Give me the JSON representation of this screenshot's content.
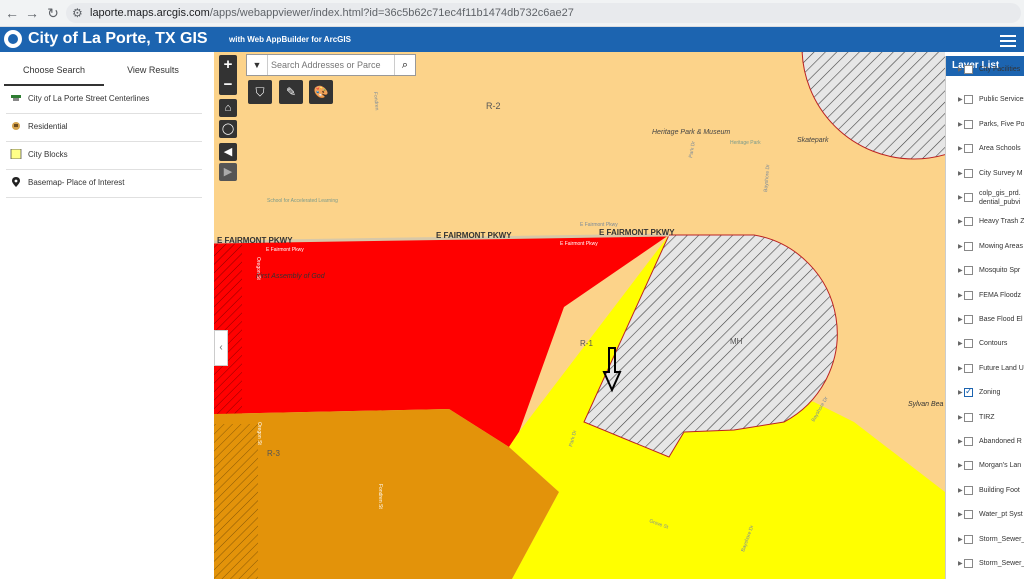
{
  "browser": {
    "url_host": "laporte.maps.arcgis.com",
    "url_path": "/apps/webappviewer/index.html?id=36c5b62c71ec4f11b1474db732c6ae27"
  },
  "header": {
    "title": "City of La Porte, TX GIS",
    "subtitle": "with Web AppBuilder for ArcGIS",
    "accent": "#1c64b0"
  },
  "left_panel": {
    "tabs": [
      {
        "label": "Choose Search",
        "active": true
      },
      {
        "label": "View Results",
        "active": false
      }
    ],
    "items": [
      {
        "label": "City of La Porte Street Centerlines",
        "icon": "street-layer-icon"
      },
      {
        "label": "Residential",
        "icon": "residential-layer-icon"
      },
      {
        "label": "City Blocks",
        "icon": "city-blocks-icon"
      },
      {
        "label": "Basemap- Place of Interest",
        "icon": "map-pin-icon"
      }
    ]
  },
  "search": {
    "placeholder": "Search Addresses or Parce"
  },
  "map": {
    "labels": {
      "r2": "R-2",
      "heritage": "Heritage Park & Museum",
      "heritage_small": "Heritage Park",
      "skatepark": "Skatepark",
      "school": "School for Accelerated Learning",
      "fairmont_1": "E FAIRMONT PKWY",
      "fairmont_2": "E FAIRMONT PKWY",
      "fairmont_3": "E FAIRMONT PKWY",
      "fairmont_pkwy_small": "E Fairmont Pkwy",
      "fairmont_pkwy_small2": "E Fairmont Pkwy",
      "e_fairmont_pkwy_top": "E Fairmont Pkwy",
      "assembly": "First Assembly of God",
      "r1": "R-1",
      "mh": "MH",
      "r3": "R-3",
      "sylvan": "Sylvan Bea",
      "park_dr": "Park Dr",
      "park_dr2": "Park Dr",
      "bayshore": "Bayshore Dr",
      "bayshore2": "Bayshore Dr",
      "bayshore3": "Bayshore Dr",
      "grove": "Grove St",
      "fondren": "Fondren",
      "oregon": "Oregon St",
      "oregon2": "Oregon St",
      "fondren2": "Fondren St"
    },
    "colors": {
      "r2_zone": "#fcd38a",
      "red_zone": "#ff0000",
      "yellow_zone": "#ffff00",
      "orange_zone": "#e3930a",
      "mh_zone": "#e6e6e6"
    }
  },
  "layer_list": {
    "title": "Layer List",
    "items": [
      {
        "label": "City Facilities",
        "checked": false
      },
      {
        "label": "Public Services",
        "checked": false
      },
      {
        "label": "Parks, Five Points",
        "checked": false
      },
      {
        "label": "Area Schools",
        "checked": false
      },
      {
        "label": "City Survey M",
        "checked": false
      },
      {
        "label": "colp_gis_prd.",
        "label2": "dential_pubvi",
        "checked": false
      },
      {
        "label": "Heavy Trash Z",
        "checked": false
      },
      {
        "label": "Mowing Areas",
        "checked": false
      },
      {
        "label": "Mosquito Spr",
        "checked": false
      },
      {
        "label": "FEMA Floodz",
        "checked": false
      },
      {
        "label": "Base Flood El",
        "checked": false
      },
      {
        "label": "Contours",
        "checked": false
      },
      {
        "label": "Future Land U",
        "checked": false
      },
      {
        "label": "Zoning",
        "checked": true
      },
      {
        "label": "TIRZ",
        "checked": false
      },
      {
        "label": "Abandoned R",
        "checked": false
      },
      {
        "label": "Morgan's Lan",
        "checked": false
      },
      {
        "label": "Building Foot",
        "checked": false
      },
      {
        "label": "Water_pt Syst",
        "checked": false
      },
      {
        "label": "Storm_Sewer_",
        "checked": false
      },
      {
        "label": "Storm_Sewer_",
        "checked": false
      }
    ]
  }
}
